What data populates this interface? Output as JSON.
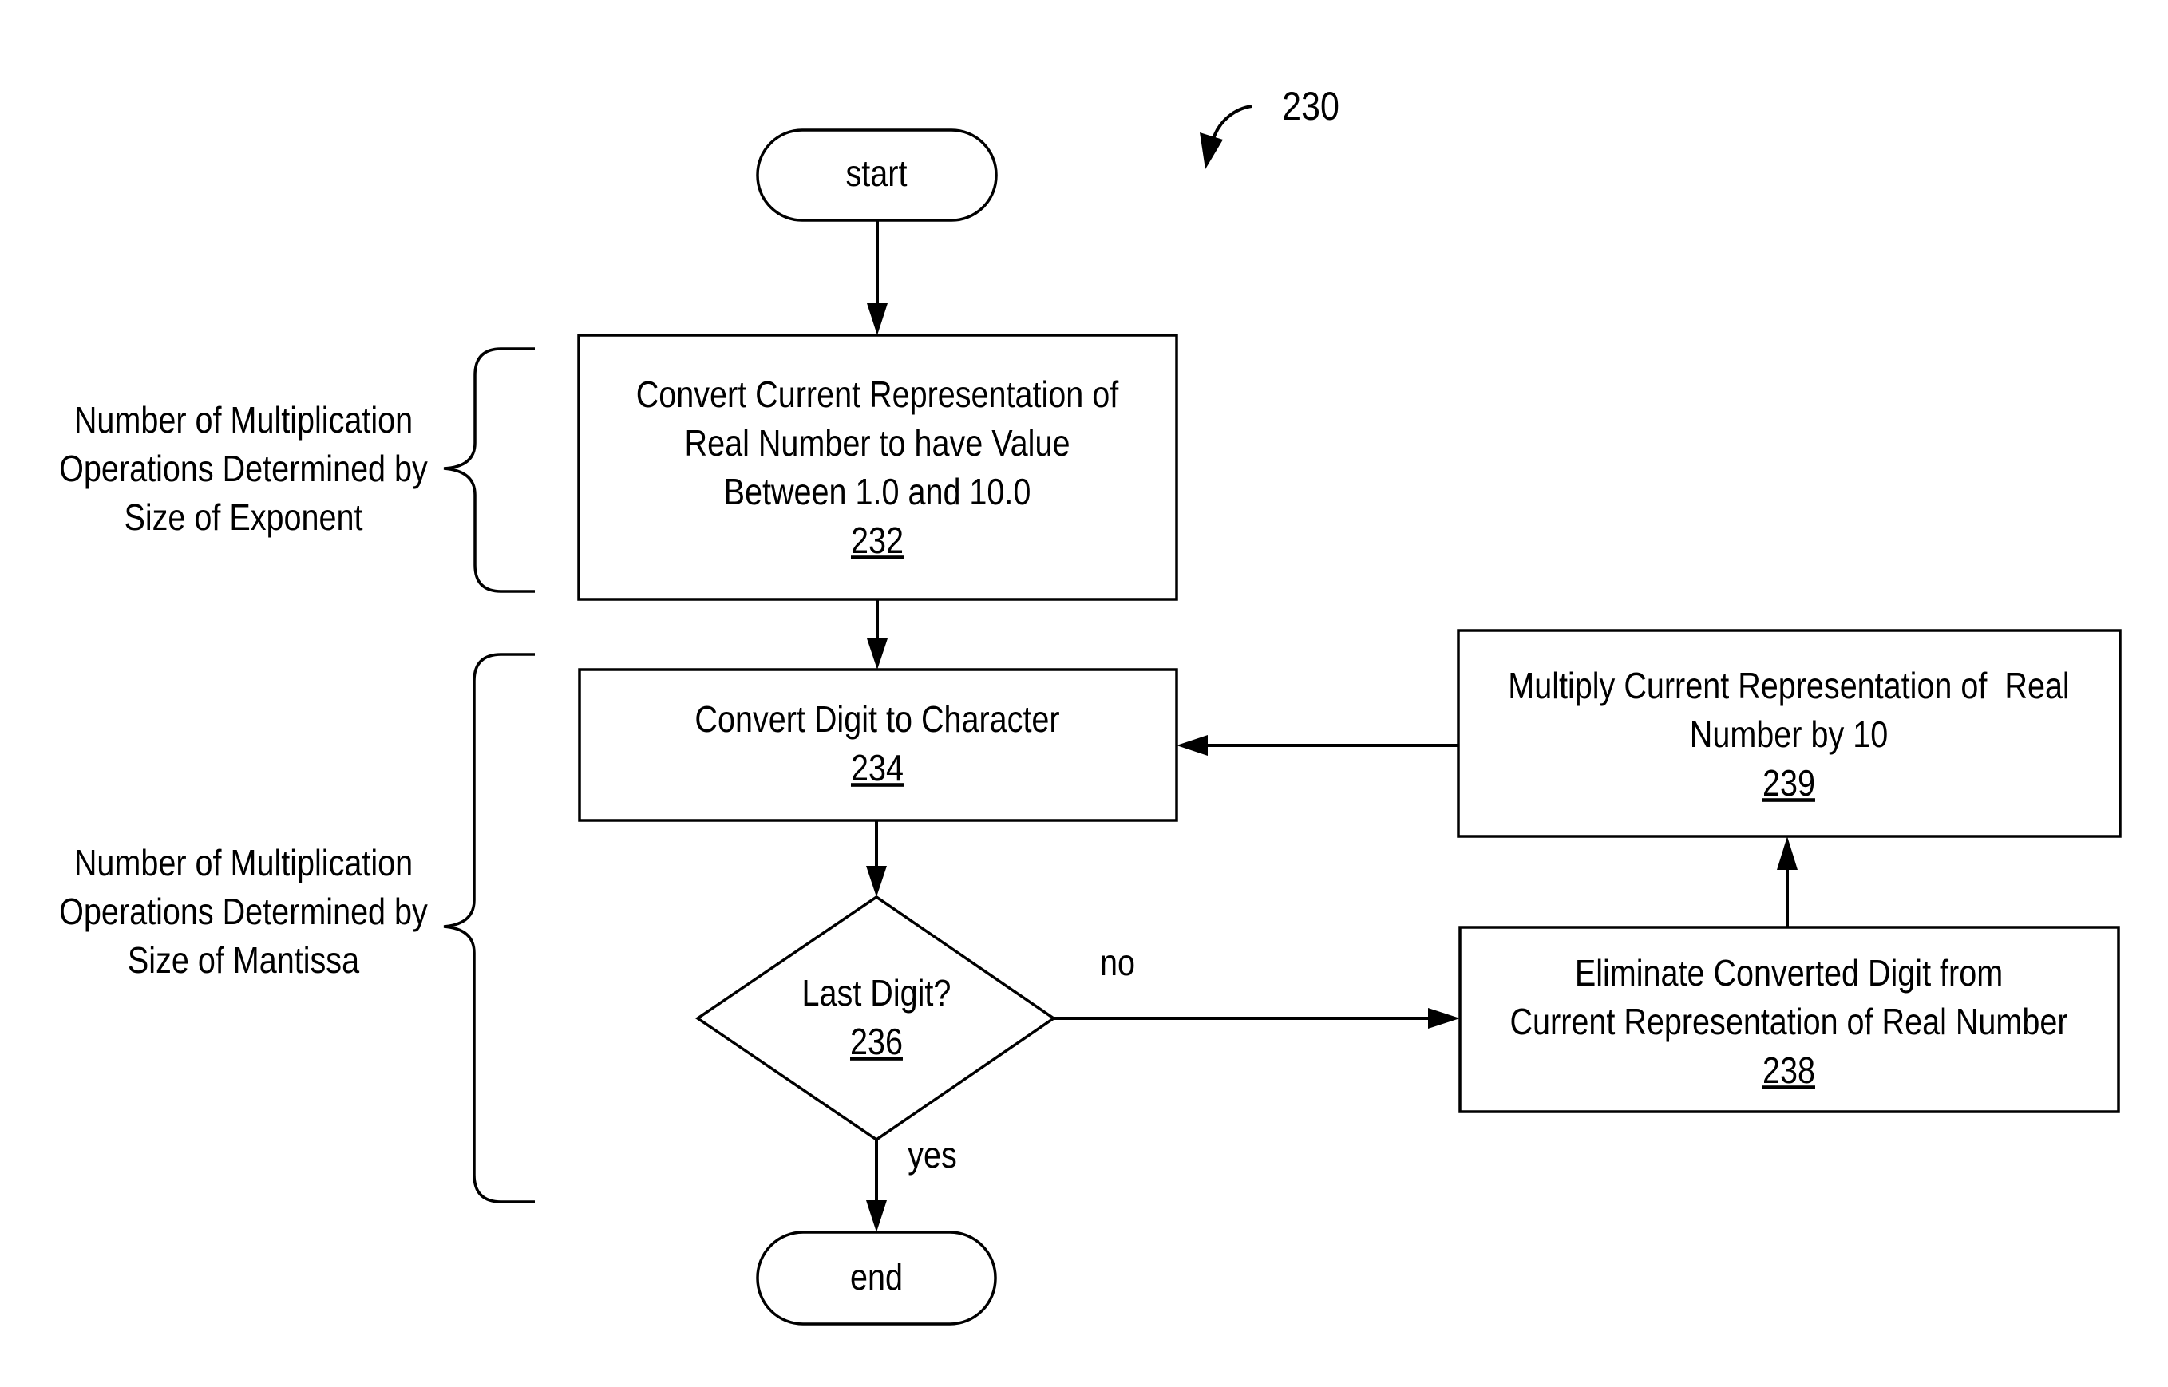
{
  "figure": {
    "reference_number": "230",
    "start_label": "start",
    "end_label": "end"
  },
  "steps": {
    "s232": {
      "lines": [
        "Convert Current Representation of",
        "Real Number to have Value",
        "Between 1.0 and 10.0"
      ],
      "ref": "232"
    },
    "s234": {
      "lines": [
        "Convert Digit to Character"
      ],
      "ref": "234"
    },
    "s236": {
      "lines": [
        "Last Digit?"
      ],
      "ref": "236"
    },
    "s238": {
      "lines": [
        "Eliminate Converted Digit from",
        "Current Representation of Real Number"
      ],
      "ref": "238"
    },
    "s239": {
      "lines": [
        "Multiply Current Representation of  Real",
        "Number by 10"
      ],
      "ref": "239"
    }
  },
  "branches": {
    "no": "no",
    "yes": "yes"
  },
  "annotations": {
    "exponent": {
      "lines": [
        "Number of Multiplication",
        "Operations Determined by",
        "Size of Exponent"
      ]
    },
    "mantissa": {
      "lines": [
        "Number of Multiplication",
        "Operations Determined by",
        "Size of Mantissa"
      ]
    }
  }
}
